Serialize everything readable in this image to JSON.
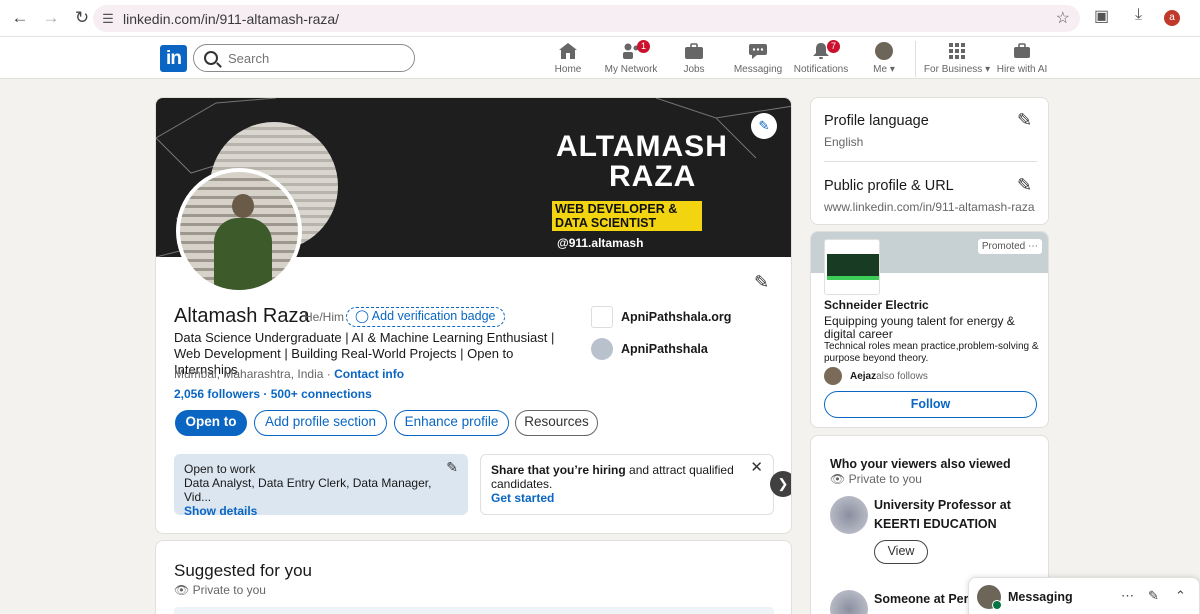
{
  "browser": {
    "url": "linkedin.com/in/911-altamash-raza/",
    "avatar_letter": "a"
  },
  "nav": {
    "logo": "in",
    "search_placeholder": "Search",
    "items": [
      {
        "label": "Home",
        "icon": "home-icon"
      },
      {
        "label": "My Network",
        "icon": "network-icon",
        "badge": "1"
      },
      {
        "label": "Jobs",
        "icon": "briefcase-icon"
      },
      {
        "label": "Messaging",
        "icon": "chat-icon"
      },
      {
        "label": "Notifications",
        "icon": "bell-icon",
        "badge": "7"
      },
      {
        "label": "Me",
        "icon": "avatar"
      },
      {
        "label": "For Business",
        "icon": "grid-icon"
      },
      {
        "label": "Hire with AI",
        "icon": "briefcase-icon"
      }
    ]
  },
  "banner": {
    "first_name": "ALTAMASH",
    "last_name": "RAZA",
    "role": "WEB DEVELOPER & DATA SCIENTIST",
    "handle": "@911.altamash"
  },
  "profile": {
    "name": "Altamash Raza",
    "pronouns": "He/Him",
    "verify_badge": "Add verification badge",
    "headline": "Data Science Undergraduate | AI & Machine Learning Enthusiast | Web Development | Building Real-World Projects | Open to Internships",
    "location": "Mumbai, Maharashtra, India",
    "separator": " · ",
    "contact_info": "Contact info",
    "followers": "2,056 followers",
    "connections": "500+ connections",
    "buttons": {
      "open_to": "Open to",
      "add_section": "Add profile section",
      "enhance": "Enhance profile",
      "resources": "Resources"
    },
    "orgs": [
      {
        "name": "ApniPathshala.org"
      },
      {
        "name": "ApniPathshala"
      }
    ],
    "open_to_work": {
      "title": "Open to work",
      "roles": "Data Analyst, Data Entry Clerk, Data Manager, Vid...",
      "link": "Show details"
    },
    "hiring": {
      "bold": "Share that you’re hiring",
      "rest": " and attract qualified candidates.",
      "link": "Get started"
    }
  },
  "suggested": {
    "title": "Suggested for you",
    "privacy": "Private to you"
  },
  "right": {
    "profile_language": {
      "title": "Profile language",
      "value": "English"
    },
    "public_profile": {
      "title": "Public profile & URL",
      "value": "www.linkedin.com/in/911-altamash-raza"
    },
    "ad": {
      "promoted": "Promoted",
      "company": "Schneider Electric",
      "tagline": "Equipping young talent for energy & digital career",
      "description": "Technical roles mean practice,problem-solving & purpose beyond theory.",
      "follower_name": "Aejaz",
      "follower_text": " also follows",
      "follow_button": "Follow"
    },
    "viewers": {
      "title": "Who your viewers also viewed",
      "privacy": "Private to you",
      "people": [
        {
          "title": "University Professor at KEERTI EDUCATION"
        },
        {
          "title": "Someone at Pers"
        }
      ],
      "view_button": "View"
    }
  },
  "messaging": {
    "title": "Messaging"
  },
  "colors": {
    "brand": "#0a66c2",
    "badge": "#cb112d",
    "banner_accent": "#f2d410"
  }
}
